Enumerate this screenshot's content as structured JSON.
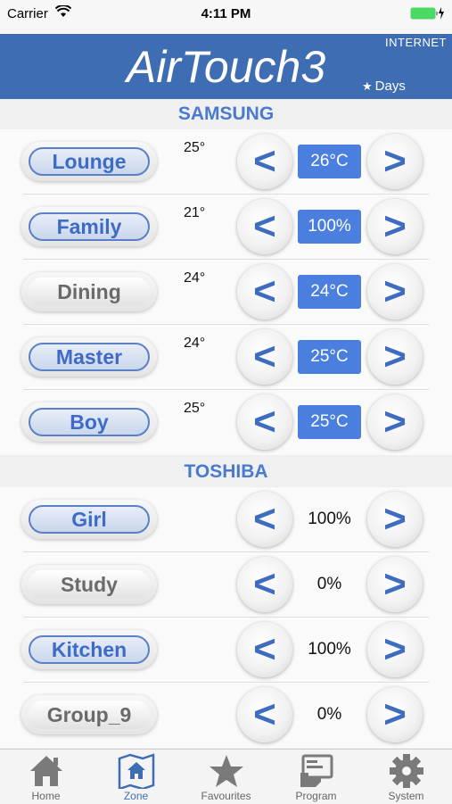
{
  "status_bar": {
    "carrier": "Carrier",
    "time": "4:11 PM"
  },
  "header": {
    "title": "AirTouch3",
    "internet": "INTERNET",
    "days": "Days"
  },
  "groups": [
    {
      "name": "SAMSUNG"
    },
    {
      "name": "TOSHIBA"
    }
  ],
  "zones": [
    {
      "name": "Lounge",
      "room_temp": "25°",
      "setpoint": "26°C",
      "state": "on"
    },
    {
      "name": "Family",
      "room_temp": "21°",
      "setpoint": "100%",
      "state": "on"
    },
    {
      "name": "Dining",
      "room_temp": "24°",
      "setpoint": "24°C",
      "state": "off"
    },
    {
      "name": "Master",
      "room_temp": "24°",
      "setpoint": "25°C",
      "state": "on"
    },
    {
      "name": "Boy",
      "room_temp": "25°",
      "setpoint": "25°C",
      "state": "on"
    },
    {
      "name": "Girl",
      "room_temp": "",
      "setpoint": "100%",
      "state": "on"
    },
    {
      "name": "Study",
      "room_temp": "",
      "setpoint": "0%",
      "state": "off"
    },
    {
      "name": "Kitchen",
      "room_temp": "",
      "setpoint": "100%",
      "state": "on"
    },
    {
      "name": "Group_9",
      "room_temp": "",
      "setpoint": "0%",
      "state": "off"
    }
  ],
  "controls": {
    "decrease": "<",
    "increase": ">"
  },
  "tabs": [
    {
      "label": "Home",
      "icon": "home-icon"
    },
    {
      "label": "Zone",
      "icon": "zone-map-icon"
    },
    {
      "label": "Favourites",
      "icon": "star-icon"
    },
    {
      "label": "Program",
      "icon": "program-icon"
    },
    {
      "label": "System",
      "icon": "gear-icon"
    }
  ],
  "colors": {
    "header_bg": "#3f6db3",
    "accent": "#4a7fe0",
    "group_text": "#4a7ad0"
  }
}
